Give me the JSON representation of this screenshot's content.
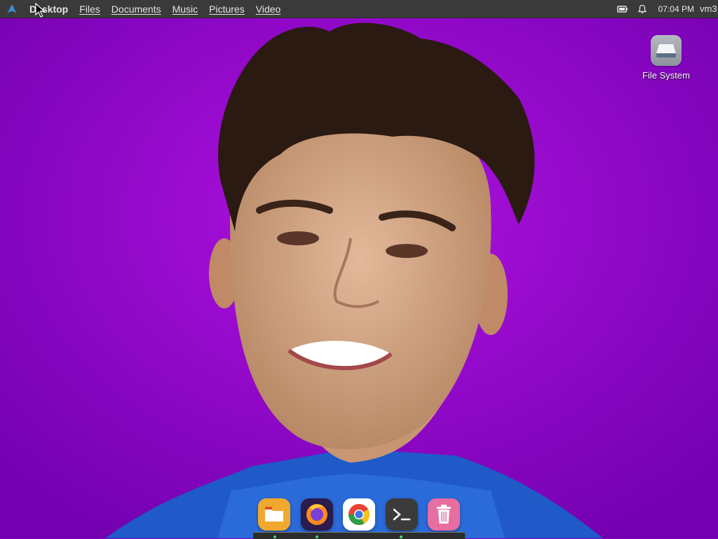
{
  "top_panel": {
    "logo_icon": "arch-logo-icon",
    "menu": [
      "Desktop",
      "Files",
      "Documents",
      "Music",
      "Pictures",
      "Video"
    ],
    "active_menu": "Desktop",
    "tray_icons": [
      "battery-icon",
      "bell-icon"
    ],
    "clock": "07:04 PM",
    "username": "vm3"
  },
  "desktop_icons": [
    {
      "label": "File System",
      "icon": "drive-icon"
    }
  ],
  "dock": {
    "items": [
      "files",
      "firefox",
      "chrome",
      "terminal",
      "trash"
    ],
    "running_indicators": [
      "files",
      "chrome",
      "terminal"
    ]
  },
  "colors": {
    "wallpaper_background": "#8a00c8",
    "panel_background": "#3a3a3a",
    "panel_text": "#e6e6e6"
  }
}
